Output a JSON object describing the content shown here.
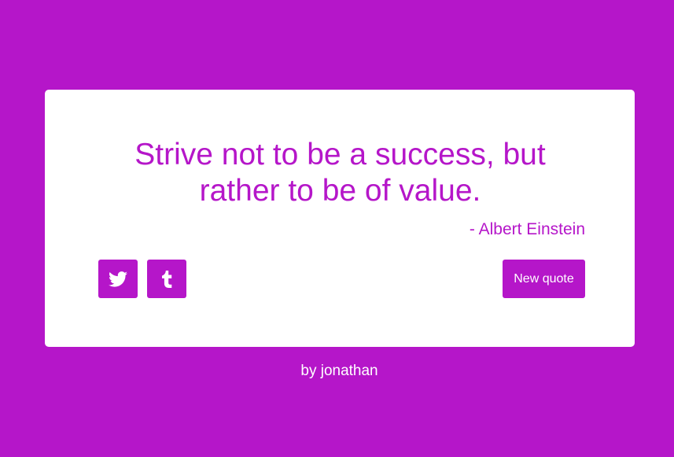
{
  "colors": {
    "background": "#b516c9",
    "card": "#ffffff",
    "accent": "#b516c9",
    "button_text": "#ffffff"
  },
  "quote": {
    "text": "Strive not to be a success, but rather to be of value.",
    "author": "- Albert Einstein"
  },
  "actions": {
    "twitter_icon": "twitter-bird-icon",
    "tumblr_icon": "tumblr-t-icon",
    "new_quote_label": "New quote"
  },
  "footer": {
    "byline": "by jonathan"
  }
}
